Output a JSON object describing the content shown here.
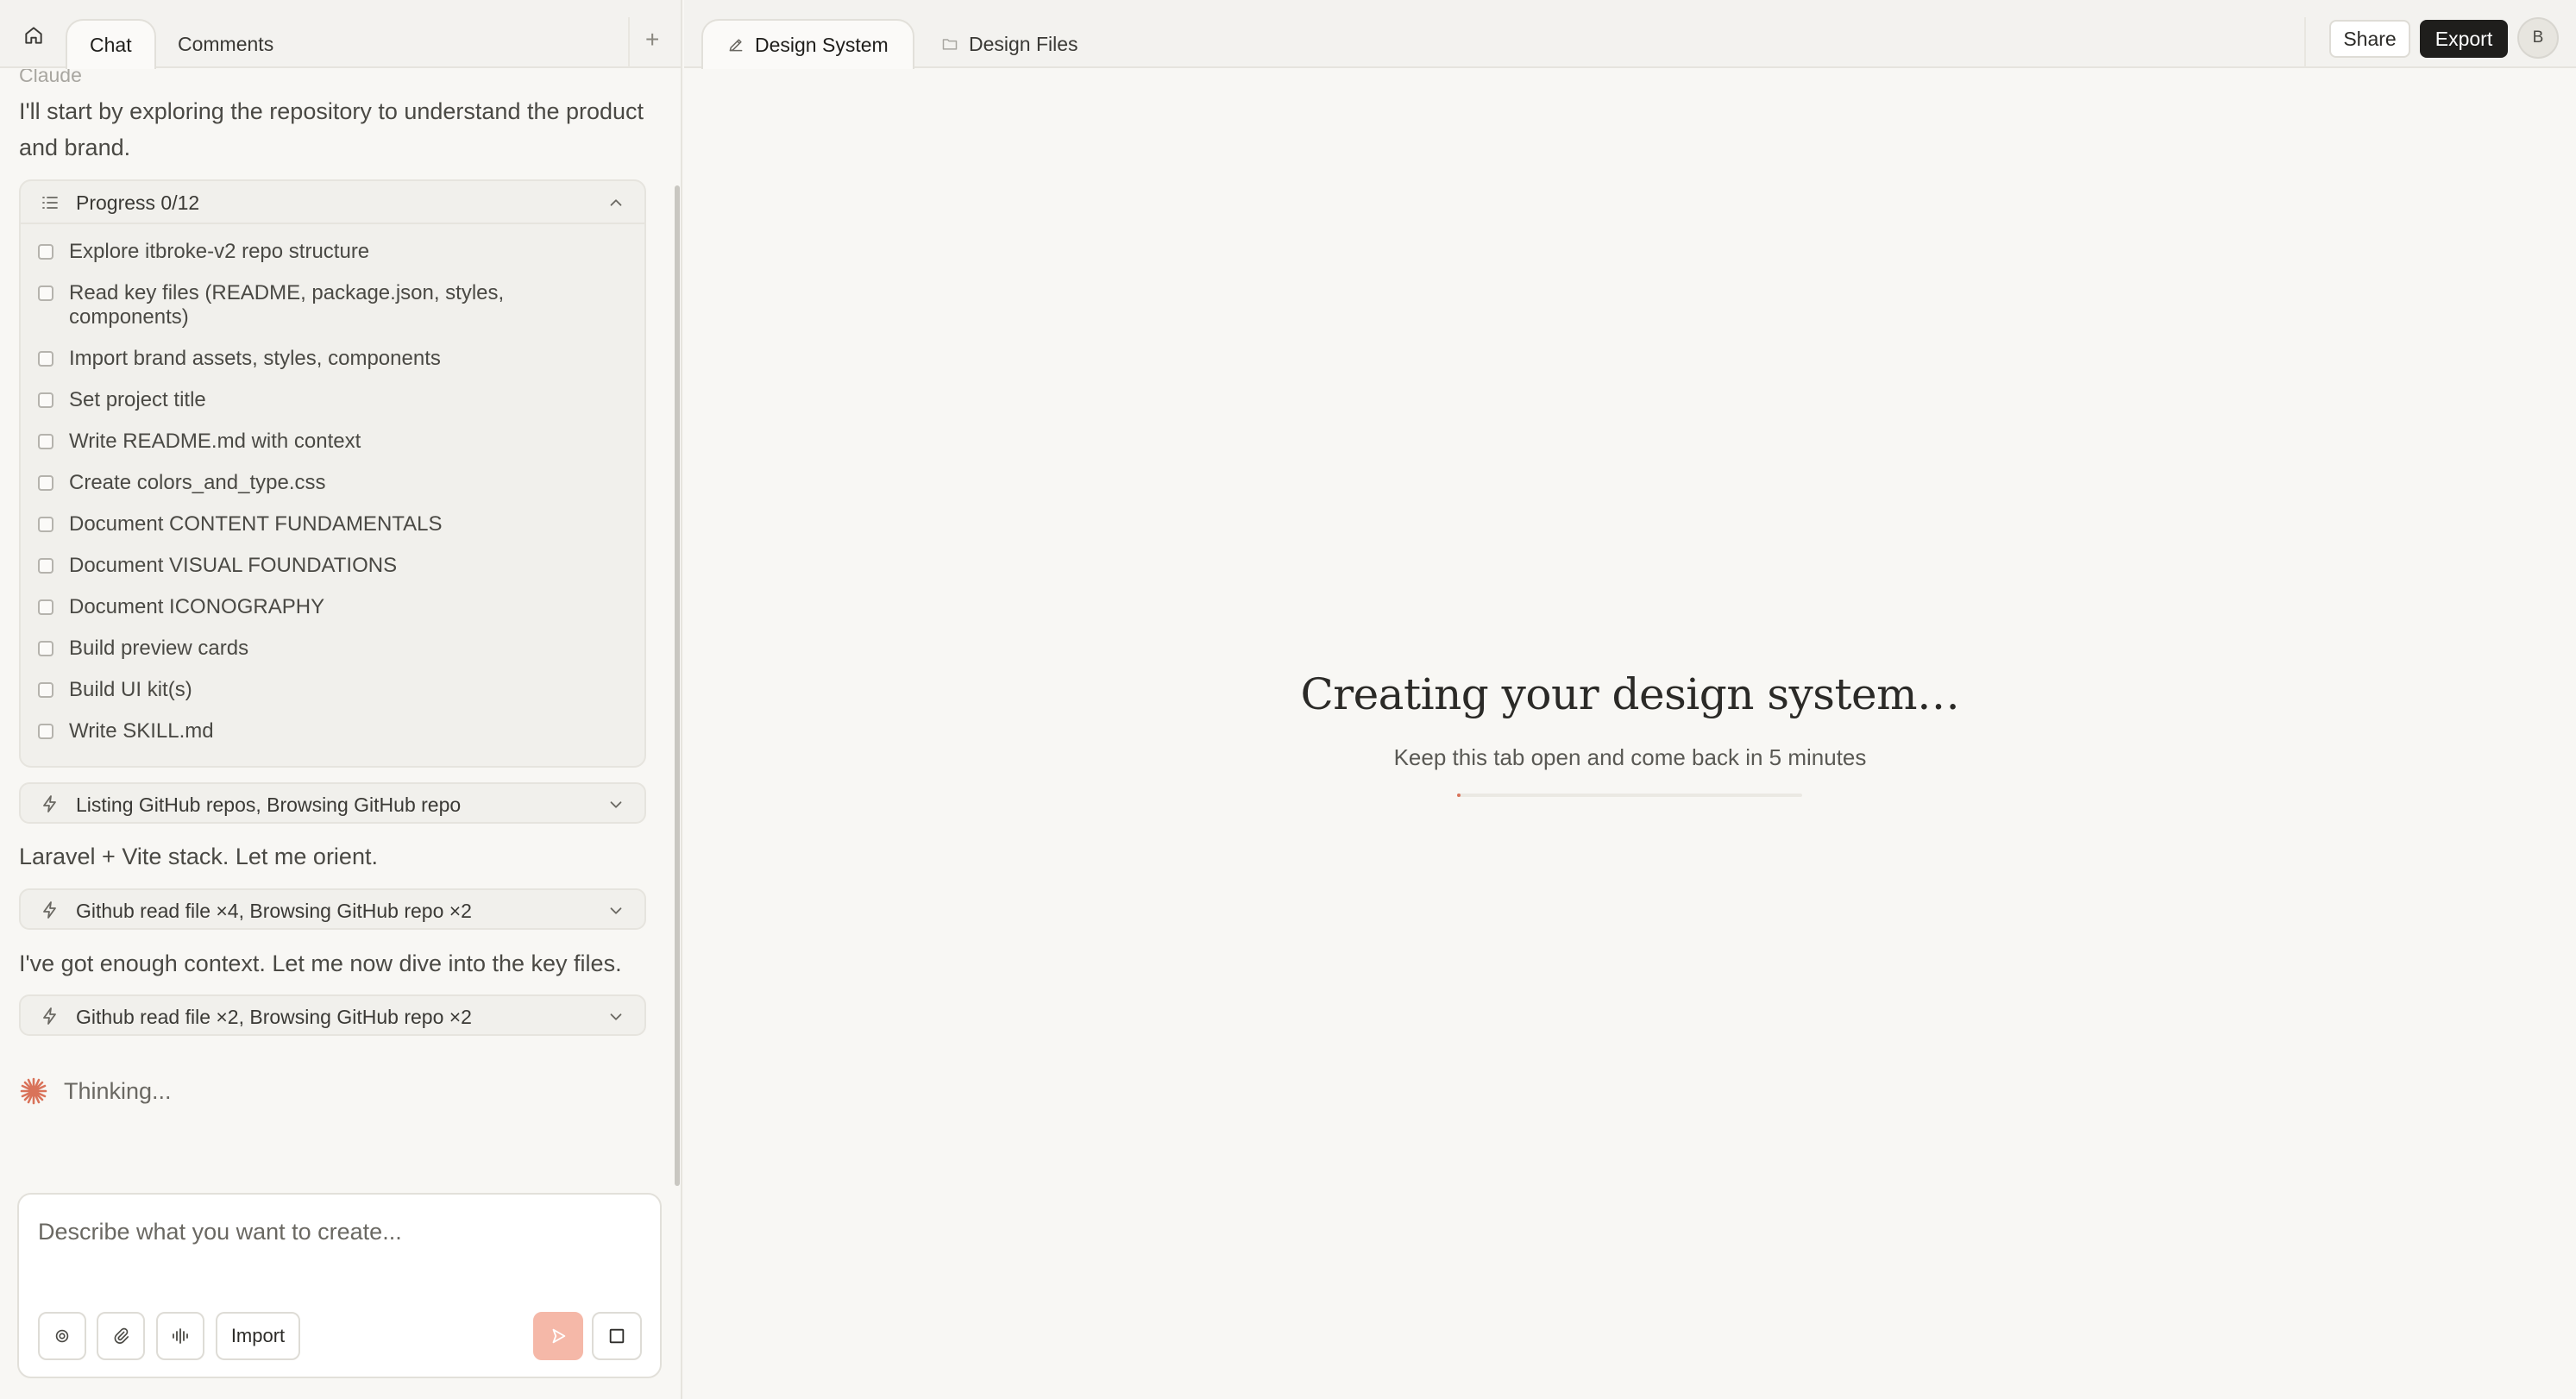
{
  "left_tabs": {
    "chat": "Chat",
    "comments": "Comments",
    "add": "+"
  },
  "chat": {
    "sender": "Claude",
    "intro": "I'll start by exploring the repository to understand the product and brand.",
    "progress": {
      "title": "Progress 0/12",
      "completed": 0,
      "total": 12,
      "tasks": [
        "Explore itbroke-v2 repo structure",
        "Read key files (README, package.json, styles, components)",
        "Import brand assets, styles, components",
        "Set project title",
        "Write README.md with context",
        "Create colors_and_type.css",
        "Document CONTENT FUNDAMENTALS",
        "Document VISUAL FOUNDATIONS",
        "Document ICONOGRAPHY",
        "Build preview cards",
        "Build UI kit(s)",
        "Write SKILL.md"
      ]
    },
    "tool1": "Listing GitHub repos, Browsing GitHub repo",
    "msg1": "Laravel + Vite stack. Let me orient.",
    "tool2": "Github read file ×4, Browsing GitHub repo ×2",
    "msg2": "I've got enough context. Let me now dive into the key files.",
    "tool3": "Github read file ×2, Browsing GitHub repo ×2",
    "thinking": "Thinking..."
  },
  "composer": {
    "placeholder": "Describe what you want to create...",
    "import_label": "Import"
  },
  "right_tabs": {
    "design_system": "Design System",
    "design_files": "Design Files"
  },
  "header": {
    "share": "Share",
    "export": "Export",
    "avatar_initial": "B"
  },
  "canvas": {
    "title": "Creating your design system…",
    "subtitle": "Keep this tab open and come back in 5 minutes",
    "progress_fraction": 0.01
  },
  "colors": {
    "accent": "#d9735a",
    "send_button": "#f5b8a8",
    "export_button": "#1f1e1c",
    "background": "#f8f7f4"
  }
}
